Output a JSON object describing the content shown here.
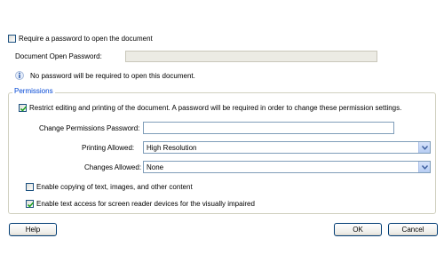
{
  "require_password": {
    "checked": false,
    "label": "Require a password to open the document"
  },
  "open_password": {
    "label": "Document Open Password:",
    "value": ""
  },
  "info_message": "No password will be required to open this document.",
  "permissions": {
    "group_title": "Permissions",
    "restrict": {
      "checked": true,
      "label": "Restrict editing and printing of the document. A password will be required in order to change these permission settings."
    },
    "change_password": {
      "label": "Change Permissions Password:",
      "value": ""
    },
    "printing": {
      "label": "Printing Allowed:",
      "selected": "High Resolution"
    },
    "changes": {
      "label": "Changes Allowed:",
      "selected": "None"
    },
    "enable_copying": {
      "checked": false,
      "label": "Enable copying of text, images, and other content"
    },
    "screen_reader": {
      "checked": true,
      "label": "Enable text access for screen reader devices for the visually impaired"
    }
  },
  "buttons": {
    "help": "Help",
    "ok": "OK",
    "cancel": "Cancel"
  },
  "colors": {
    "accent": "#0046d5",
    "checkmark": "#21a121"
  }
}
